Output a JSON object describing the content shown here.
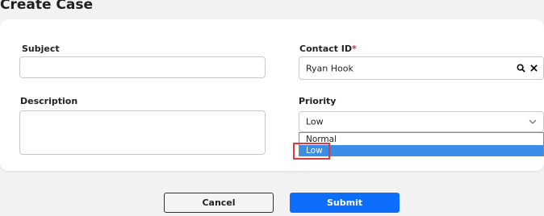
{
  "page": {
    "title": "Create Case"
  },
  "form": {
    "subject": {
      "label": "Subject",
      "value": ""
    },
    "contact": {
      "label": "Contact ID",
      "required_mark": "*",
      "value": "Ryan Hook",
      "search_icon": "search-icon",
      "clear_icon": "close-icon"
    },
    "description": {
      "label": "Description",
      "value": ""
    },
    "priority": {
      "label": "Priority",
      "value": "Low",
      "options": [
        "Normal",
        "Low"
      ],
      "selected_option": "Low"
    }
  },
  "buttons": {
    "cancel": "Cancel",
    "submit": "Submit"
  },
  "colors": {
    "accent": "#0d6efd",
    "selected_option": "#3b8ee8",
    "highlight": "#e03b3b",
    "required": "#d9262d"
  }
}
